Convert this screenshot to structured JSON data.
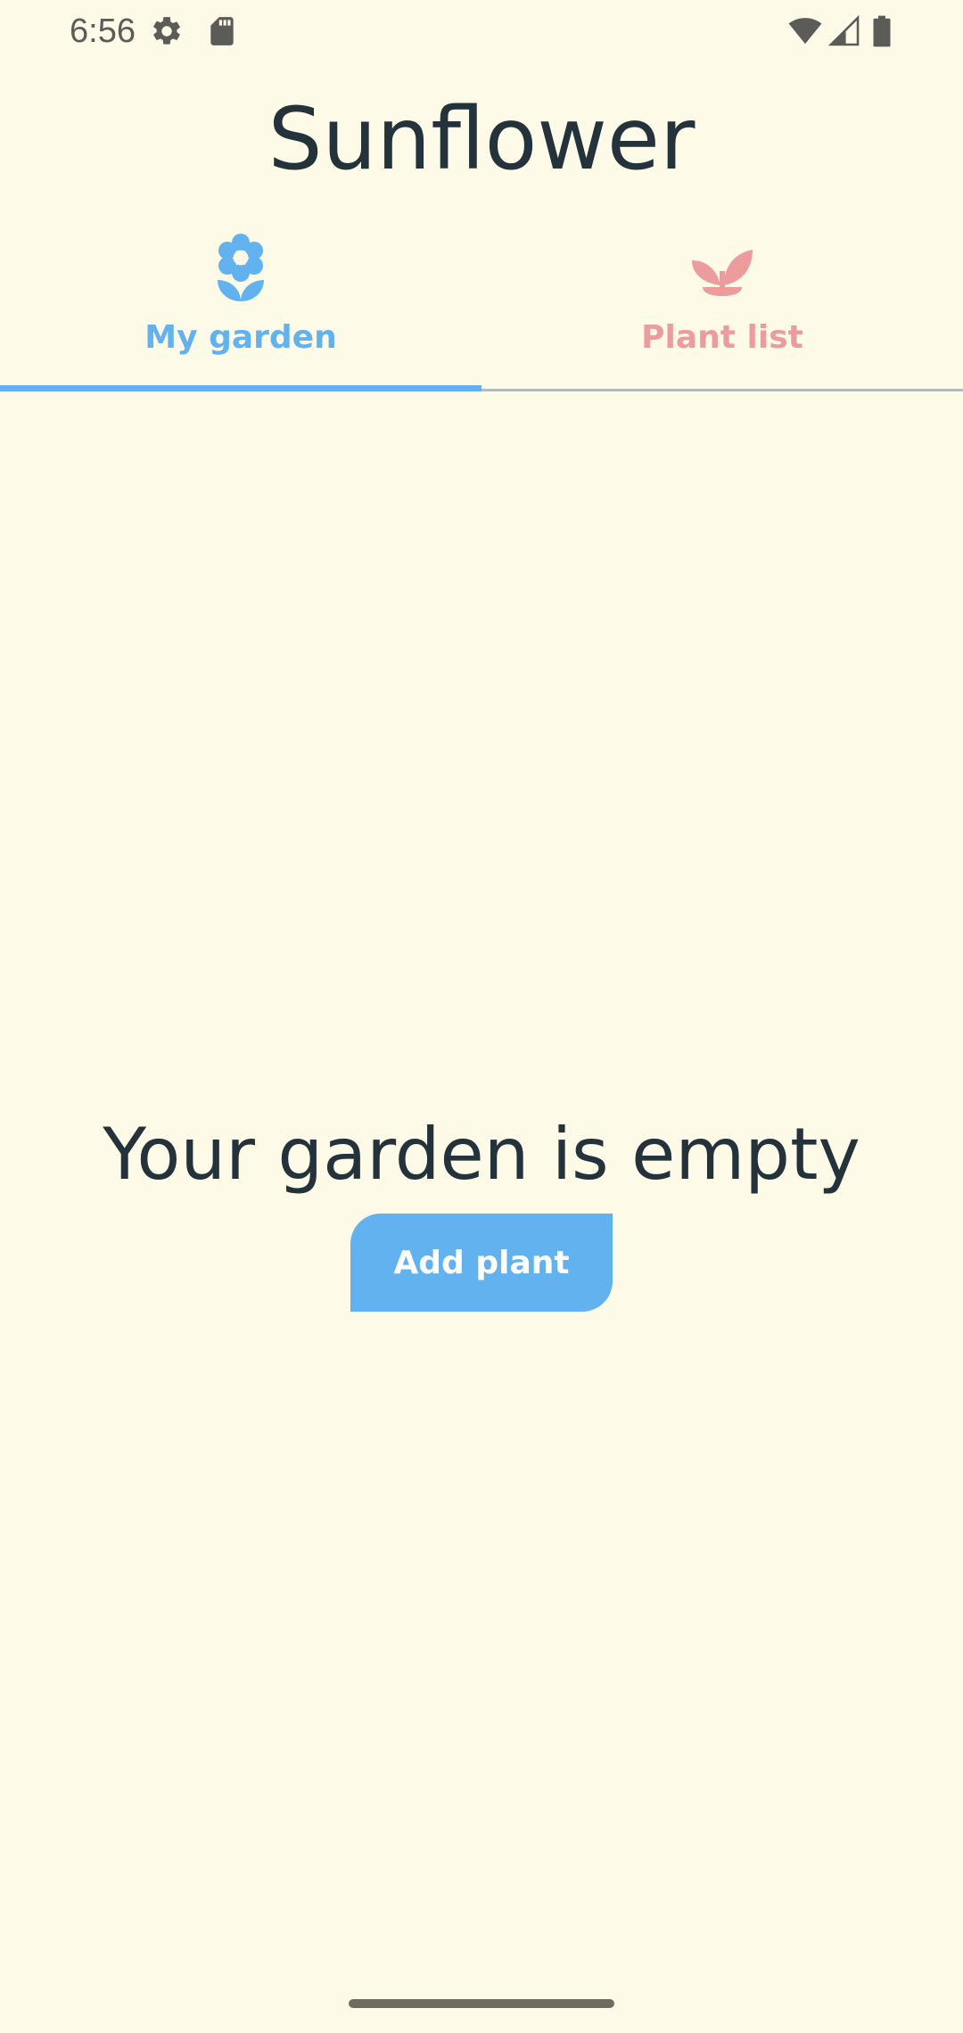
{
  "status_bar": {
    "time": "6:56",
    "icons": [
      "settings-icon",
      "sd-card-icon",
      "wifi-icon",
      "cell-signal-icon",
      "battery-icon"
    ]
  },
  "app": {
    "title": "Sunflower"
  },
  "tabs": [
    {
      "label": "My garden",
      "icon": "flower-icon",
      "selected": true,
      "color": "#63b2f0"
    },
    {
      "label": "Plant list",
      "icon": "sprout-icon",
      "selected": false,
      "color": "#ed9c9e"
    }
  ],
  "empty_state": {
    "message": "Your garden is empty",
    "button_label": "Add plant"
  },
  "colors": {
    "background": "#fdfae7",
    "accent": "#63b2f0",
    "secondary": "#ed9c9e",
    "text": "#24323b"
  }
}
